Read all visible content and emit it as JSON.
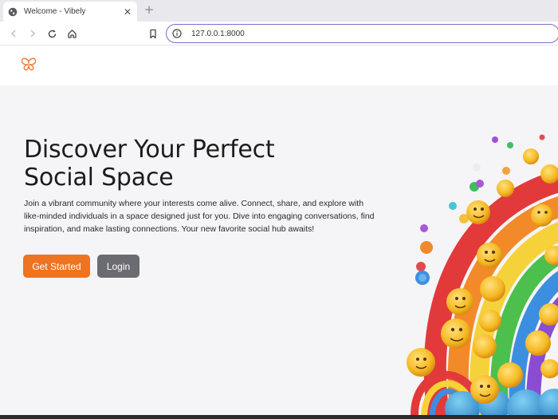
{
  "browser": {
    "tab": {
      "title": "Welcome - Vibely",
      "favicon": "globe-icon",
      "close_icon": "close-icon"
    },
    "new_tab_icon": "plus-icon",
    "toolbar": {
      "icons": [
        "back-arrow-icon",
        "forward-arrow-icon",
        "reload-icon",
        "home-icon",
        "bookmark-icon"
      ],
      "address": {
        "url": "127.0.0.1:8000",
        "info_icon": "info-icon"
      }
    },
    "accent_color": "#7b6fc7"
  },
  "site": {
    "logo_icon": "butterfly-icon",
    "hero": {
      "heading_line1": "Discover Your Perfect",
      "heading_line2": "Social Space",
      "description": "Join a vibrant community where your interests come alive. Connect, share, and explore with like-minded individuals in a space designed just for you. Dive into engaging conversations, find inspiration, and make lasting connections. Your new favorite social hub awaits!",
      "primary_button": "Get Started",
      "secondary_button": "Login",
      "illustration": "rainbow-emoji-illustration"
    },
    "colors": {
      "primary_button": "#ee7421",
      "secondary_button": "#6b6b72",
      "logo": "#ee7a3a",
      "hero_background": "#f5f4f6"
    }
  }
}
